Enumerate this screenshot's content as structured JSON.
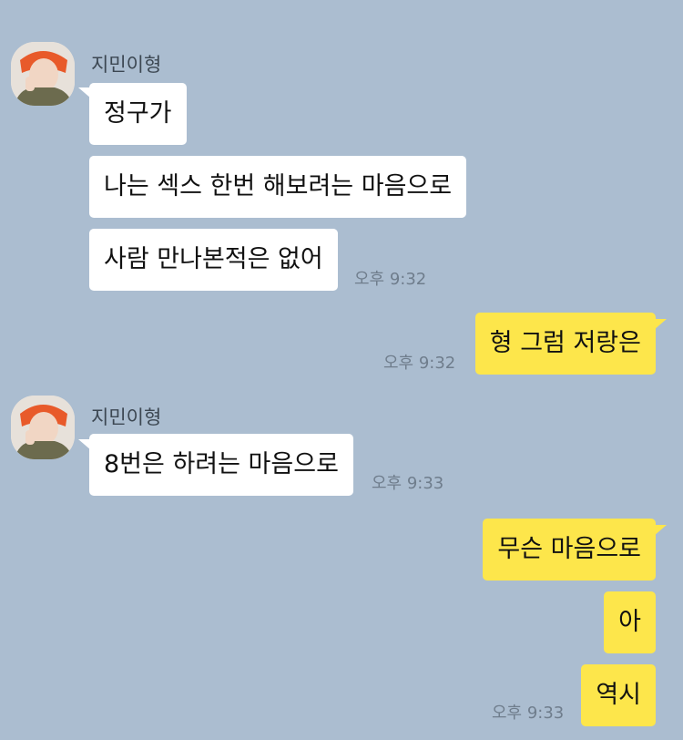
{
  "colors": {
    "background": "#abbdd0",
    "incoming_bubble": "#ffffff",
    "outgoing_bubble": "#fde64b"
  },
  "groups": [
    {
      "sender": "지민이형",
      "messages": [
        "정구가",
        "나는 섹스 한번 해보려는 마음으로",
        "사람 만나본적은 없어"
      ],
      "time": "오후 9:32"
    },
    {
      "outgoing": "형 그럼 저랑은",
      "time": "오후 9:32"
    },
    {
      "sender": "지민이형",
      "messages": [
        "8번은 하려는 마음으로"
      ],
      "time": "오후 9:33"
    },
    {
      "outgoing_messages": [
        "무슨 마음으로",
        "아",
        "역시"
      ],
      "time": "오후 9:33"
    }
  ]
}
